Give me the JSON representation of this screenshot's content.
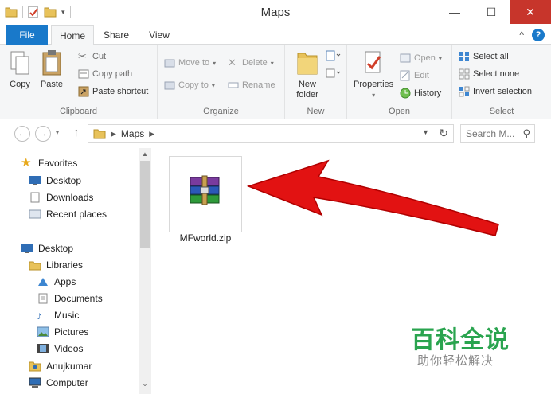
{
  "window": {
    "title": "Maps",
    "minimize": "—",
    "maximize": "☐",
    "close": "✕"
  },
  "tabs": {
    "file": "File",
    "home": "Home",
    "share": "Share",
    "view": "View",
    "expand": "^",
    "help": "?"
  },
  "ribbon": {
    "clipboard": {
      "label": "Clipboard",
      "copy": "Copy",
      "paste": "Paste",
      "cut": "Cut",
      "copy_path": "Copy path",
      "paste_shortcut": "Paste shortcut"
    },
    "organize": {
      "label": "Organize",
      "move_to": "Move to",
      "copy_to": "Copy to",
      "delete": "Delete",
      "rename": "Rename"
    },
    "new": {
      "label": "New",
      "new_folder": "New folder"
    },
    "open": {
      "label": "Open",
      "properties": "Properties",
      "open": "Open",
      "edit": "Edit",
      "history": "History"
    },
    "select": {
      "label": "Select",
      "select_all": "Select all",
      "select_none": "Select none",
      "invert_selection": "Invert selection"
    }
  },
  "address": {
    "path": "Maps",
    "search_placeholder": "Search M..."
  },
  "nav": {
    "favorites": "Favorites",
    "desktop_fav": "Desktop",
    "downloads": "Downloads",
    "recent_places": "Recent places",
    "desktop": "Desktop",
    "libraries": "Libraries",
    "apps": "Apps",
    "documents": "Documents",
    "music": "Music",
    "pictures": "Pictures",
    "videos": "Videos",
    "user": "Anujkumar",
    "computer": "Computer"
  },
  "content": {
    "file_name": "MFworld.zip"
  },
  "watermark": {
    "line1": "百科全说",
    "line2": "助你轻松解决"
  },
  "colors": {
    "accent": "#1979ca",
    "close": "#c7352b",
    "arrow": "#e01010",
    "watermark": "#2aa44f"
  }
}
